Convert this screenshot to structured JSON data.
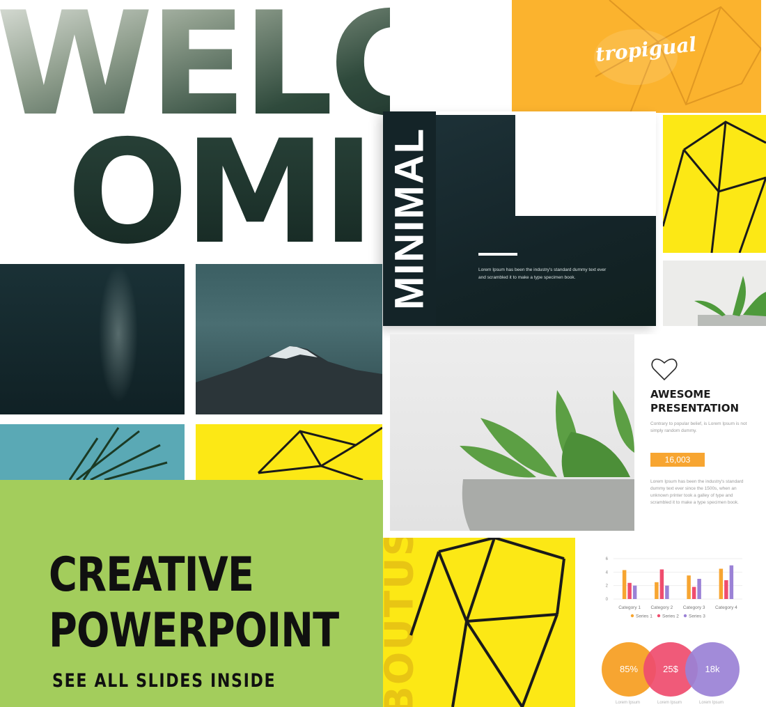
{
  "welcome": {
    "line1": "WELC",
    "line2": "OMI"
  },
  "minimal_slide": {
    "title": "MINIMAL",
    "body_line1": "Lorem Ipsum has been the industry's standard dummy text ever",
    "body_line2": "and scrambled it to make a type specimen book."
  },
  "tropigual": {
    "logo_text": "tropigual"
  },
  "boutus": {
    "word": "BOUTUS"
  },
  "awesome_slide": {
    "heading_line1": "AWESOME",
    "heading_line2": "PRESENTATION",
    "para1": "Contrary to popular belief, is Lorem Ipsum is not simply random dummy.",
    "stat": "16,003",
    "para2": "Lorem Ipsum has been the industry's standard dummy text ever since the 1500s, when an unknown printer took a galley of type and scrambled it to make a type specimen book."
  },
  "banner": {
    "title_line1": "CREATIVE",
    "title_line2": "POWERPOINT",
    "subtitle": "SEE ALL SLIDES INSIDE"
  },
  "chart_data": {
    "type": "bar",
    "categories": [
      "Category 1",
      "Category 2",
      "Category 3",
      "Category 4"
    ],
    "series": [
      {
        "name": "Series 1",
        "color": "#f7a531",
        "values": [
          4.3,
          2.5,
          3.5,
          4.5
        ]
      },
      {
        "name": "Series 2",
        "color": "#ef4d6e",
        "values": [
          2.4,
          4.4,
          1.8,
          2.8
        ]
      },
      {
        "name": "Series 3",
        "color": "#9b82d6",
        "values": [
          2,
          2,
          3,
          5
        ]
      }
    ],
    "yticks": [
      "0",
      "2",
      "4",
      "6"
    ],
    "ylim": [
      0,
      6
    ],
    "legend": "bottom"
  },
  "circles": [
    {
      "value": "85%",
      "color": "#f7a531",
      "label": "Lorem Ipsum"
    },
    {
      "value": "25$",
      "color": "#ef4d6e",
      "label": "Lorem Ipsum"
    },
    {
      "value": "18k",
      "color": "#9b82d6",
      "label": "Lorem Ipsum"
    }
  ]
}
